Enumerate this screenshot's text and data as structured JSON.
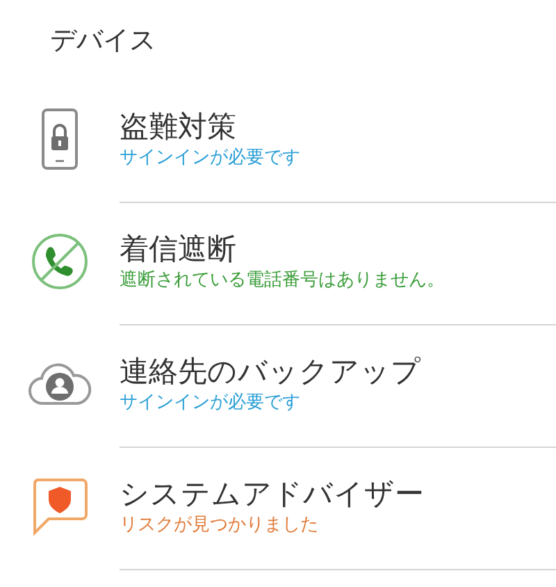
{
  "header": {
    "title": "デバイス"
  },
  "items": [
    {
      "kind": "lock",
      "title": "盗難対策",
      "status": "サインインが必要です",
      "color": "#2a9fd6"
    },
    {
      "kind": "call-block",
      "title": "着信遮断",
      "status": "遮断されている電話番号はありません。",
      "color": "#3c9e3c"
    },
    {
      "kind": "cloud",
      "title": "連絡先のバックアップ",
      "status": "サインインが必要です",
      "color": "#2a9fd6"
    },
    {
      "kind": "advisor",
      "title": "システムアドバイザー",
      "status": "リスクが見つかりました",
      "color": "#e07b39"
    }
  ]
}
